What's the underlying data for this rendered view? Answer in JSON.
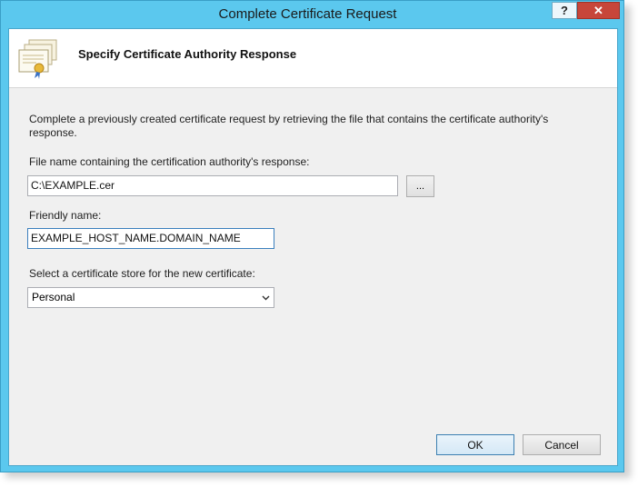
{
  "window": {
    "title": "Complete Certificate Request",
    "help_label": "?",
    "close_label": "✕"
  },
  "header": {
    "title": "Specify Certificate Authority Response",
    "icon": "certificate-icon"
  },
  "form": {
    "description": "Complete a previously created certificate request by retrieving the file that contains the certificate authority's response.",
    "file_label": "File name containing the certification authority's response:",
    "file_value": "C:\\EXAMPLE.cer",
    "browse_label": "...",
    "friendly_label": "Friendly name:",
    "friendly_value": "EXAMPLE_HOST_NAME.DOMAIN_NAME",
    "store_label": "Select a certificate store for the new certificate:",
    "store_value": "Personal"
  },
  "buttons": {
    "ok": "OK",
    "cancel": "Cancel"
  },
  "colors": {
    "titlebar": "#5bc8ee",
    "close": "#c7463a"
  }
}
